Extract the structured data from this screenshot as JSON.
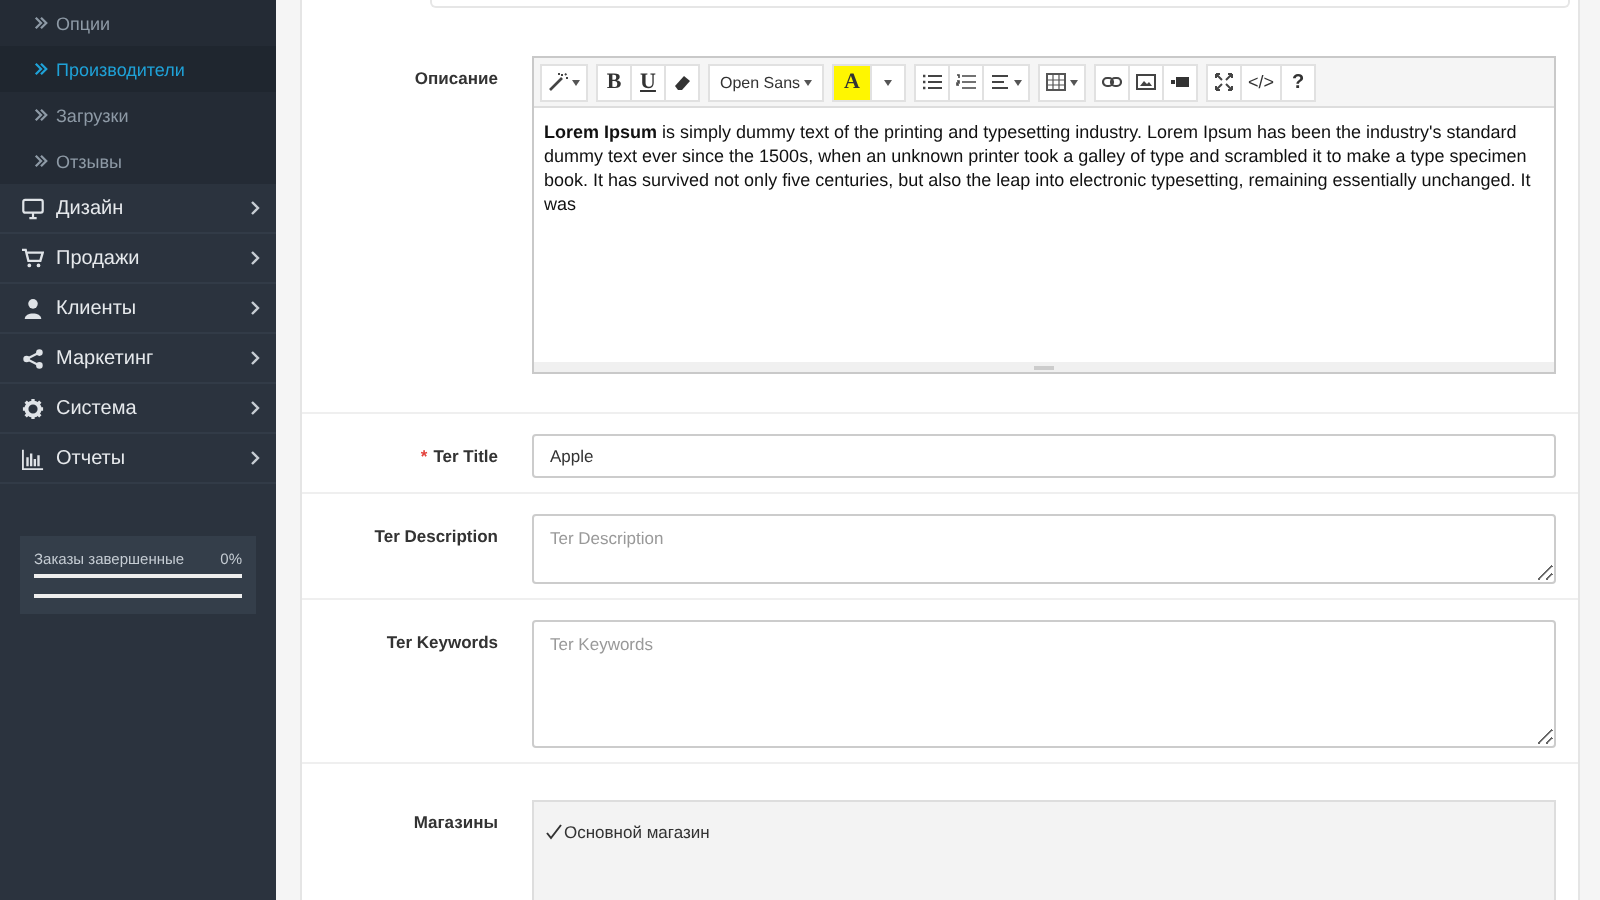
{
  "sidebar": {
    "submenu": [
      {
        "label": "Опции",
        "selected": false
      },
      {
        "label": "Производители",
        "selected": true
      },
      {
        "label": "Загрузки",
        "selected": false
      },
      {
        "label": "Отзывы",
        "selected": false
      }
    ],
    "menu": [
      {
        "label": "Дизайн"
      },
      {
        "label": "Продажи"
      },
      {
        "label": "Клиенты"
      },
      {
        "label": "Маркетинг"
      },
      {
        "label": "Система"
      },
      {
        "label": "Отчеты"
      }
    ],
    "progress": {
      "label": "Заказы завершенные",
      "reading": "0%",
      "level": 0
    }
  },
  "form": {
    "description": {
      "label": "Описание",
      "toolbar": [
        [
          {
            "kind": "style",
            "caret": true
          }
        ],
        [
          {
            "kind": "bold",
            "label": "B"
          },
          {
            "kind": "underline",
            "label": "U"
          },
          {
            "kind": "clear"
          }
        ],
        [
          {
            "kind": "font",
            "label": "Open Sans",
            "caret": true
          }
        ],
        [
          {
            "kind": "color",
            "label": "A"
          },
          {
            "kind": "colormenu",
            "caret": true
          }
        ],
        [
          {
            "kind": "ul"
          },
          {
            "kind": "ol"
          },
          {
            "kind": "align",
            "caret": true
          }
        ],
        [
          {
            "kind": "table",
            "caret": true
          }
        ],
        [
          {
            "kind": "link"
          },
          {
            "kind": "picture"
          },
          {
            "kind": "video"
          }
        ],
        [
          {
            "kind": "fullscreen"
          },
          {
            "kind": "code",
            "label": "</>"
          },
          {
            "kind": "help",
            "label": "?"
          }
        ]
      ],
      "content": "**Lorem Ipsum** is simply dummy text of the printing and typesetting industry. Lorem Ipsum has been the industry's standard dummy text ever since the 1500s, when an unknown printer took a galley of type and scrambled it to make a type specimen book. It has survived not only five centuries, but also the leap into electronic typesetting, remaining essentially unchanged. It was"
    },
    "fields": [
      {
        "kind": "input",
        "label": "Ter Title",
        "required_mark": "*",
        "value": "Apple"
      },
      {
        "kind": "textarea",
        "label": "Ter Description",
        "placeholder": "Ter Description"
      },
      {
        "kind": "textarea_tall",
        "label": "Ter Keywords",
        "placeholder": "Ter Keywords"
      }
    ],
    "stores": {
      "label": "Магазины",
      "items": [
        {
          "label": "Основной магазин",
          "checked": true
        }
      ]
    }
  }
}
